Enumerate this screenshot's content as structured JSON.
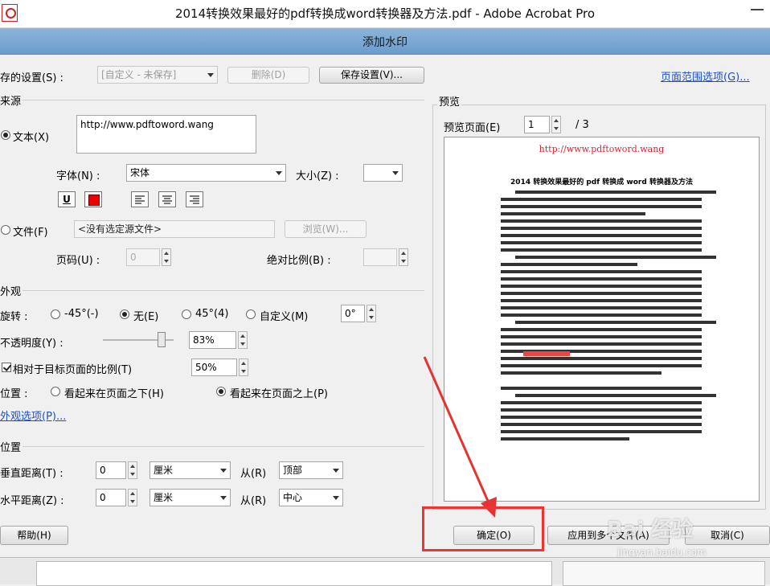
{
  "window": {
    "title": "2014转换效果最好的pdf转换成word转换器及方法.pdf - Adobe Acrobat Pro"
  },
  "dialog": {
    "title": "添加水印",
    "saved_settings_label": "存的设置(S) :",
    "saved_settings_value": "[自定义 - 未保存]",
    "delete_label": "删除(D)",
    "save_settings_label": "保存设置(V)...",
    "page_range_link": "页面范围选项(G)...",
    "source": {
      "section_label": "来源",
      "text_option": "文本(X)",
      "text_value": "http://www.pdftoword.wang",
      "font_label": "字体(N) :",
      "font_value": "宋体",
      "size_label": "大小(Z) :",
      "size_value": "",
      "underline_label": "U",
      "file_option": "文件(F)",
      "file_value": "<没有选定源文件>",
      "browse_label": "浏览(W)...",
      "page_number_label": "页码(U) :",
      "page_number_value": "0",
      "absolute_scale_label": "绝对比例(B) :"
    },
    "appearance": {
      "section_label": "外观",
      "rotation_label": "旋转 :",
      "rot_neg45": "-45°(-)",
      "rot_none": "无(E)",
      "rot_45": "45°(4)",
      "rot_custom": "自定义(M)",
      "rot_custom_value": "0°",
      "opacity_label": "不透明度(Y) :",
      "opacity_value": "83%",
      "opacity_level": 0.83,
      "relative_scale_label": "相对于目标页面的比例(T)",
      "relative_scale_value": "50%",
      "location_label": "位置 :",
      "behind_page": "看起来在页面之下(H)",
      "on_top": "看起来在页面之上(P)",
      "appearance_options_link": "外观选项(P)..."
    },
    "position": {
      "section_label": "位置",
      "vertical_label": "垂直距离(T) :",
      "vertical_value": "0",
      "vertical_unit": "厘米",
      "from_label": "从(R)",
      "vertical_from": "顶部",
      "horizontal_label": "水平距离(Z) :",
      "horizontal_value": "0",
      "horizontal_unit": "厘米",
      "horizontal_from": "中心"
    },
    "preview": {
      "section_label": "预览",
      "page_label": "预览页面(E)",
      "page_value": "1",
      "page_total": "/ 3",
      "doc_watermark": "http://www.pdftoword.wang",
      "doc_title": "2014 转换效果最好的 pdf 转换成 word 转换器及方法"
    },
    "help_label": "帮助(H)",
    "ok_label": "确定(O)",
    "apply_label": "应用到多个文件(A)",
    "cancel_label": "取消(C)",
    "watermark_text": "Bai 经验",
    "watermark_sub": "jingyan.baidu.com"
  },
  "colors": {
    "annotation_red": "#e33333",
    "dialog_title": "#7aa7d4",
    "link": "#1a4fd0"
  }
}
